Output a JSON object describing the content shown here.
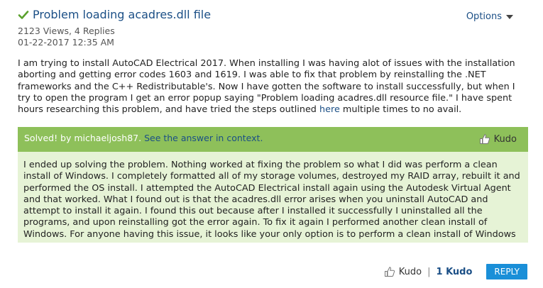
{
  "post": {
    "title": "Problem loading acadres.dll file",
    "views": "2123 Views, 4 Replies",
    "date": "01-22-2017 12:35 AM",
    "options_label": "Options",
    "body_part1": "I am trying to install AutoCAD Electrical 2017. When installing I was having alot of issues with the installation aborting and getting error codes 1603 and 1619. I was able to fix that problem by reinstalling the .NET frameworks and the C++ Redistributable's. Now I have gotten the software to install successfully, but when I try to open the program I get an error popup saying \"Problem loading acadres.dll resource file.\" I have spent hours researching this problem, and have tried the steps outlined ",
    "body_link": "here",
    "body_part2": " multiple times to no avail."
  },
  "solution": {
    "solved_by": "Solved! by michaeljosh87.",
    "context_link": "See the answer in context.",
    "kudo_label": "Kudo",
    "answer_text": "I ended up solving the problem. Nothing worked at fixing the problem so what I did was perform a clean install of Windows. I completely formatted all of my storage volumes, destroyed my RAID array, rebuilt it and performed the OS install. I attempted the AutoCAD Electrical install again using the Autodesk Virtual Agent and that worked. What I found out is that the acadres.dll error arises when you uninstall AutoCAD and attempt to install it again. I found this out because after I installed it successfully I uninstalled all the programs, and upon reinstalling got the error again. To fix it again I performed another clean install of Windows. For anyone having this issue, it looks like your only option is to perform a clean install of Windows"
  },
  "footer": {
    "kudo_label": "Kudo",
    "separator": "|",
    "kudo_count": "1 Kudo",
    "reply_label": "REPLY"
  },
  "colors": {
    "title": "#1b4f86",
    "solved_bar": "#8ec05a",
    "answer_bg": "#e6f3d6",
    "reply_button": "#1a8fd8",
    "check": "#5aa02c"
  },
  "icons": {
    "check": "check-icon",
    "options_caret": "chevron-down-icon",
    "kudo": "thumbs-up-icon"
  }
}
